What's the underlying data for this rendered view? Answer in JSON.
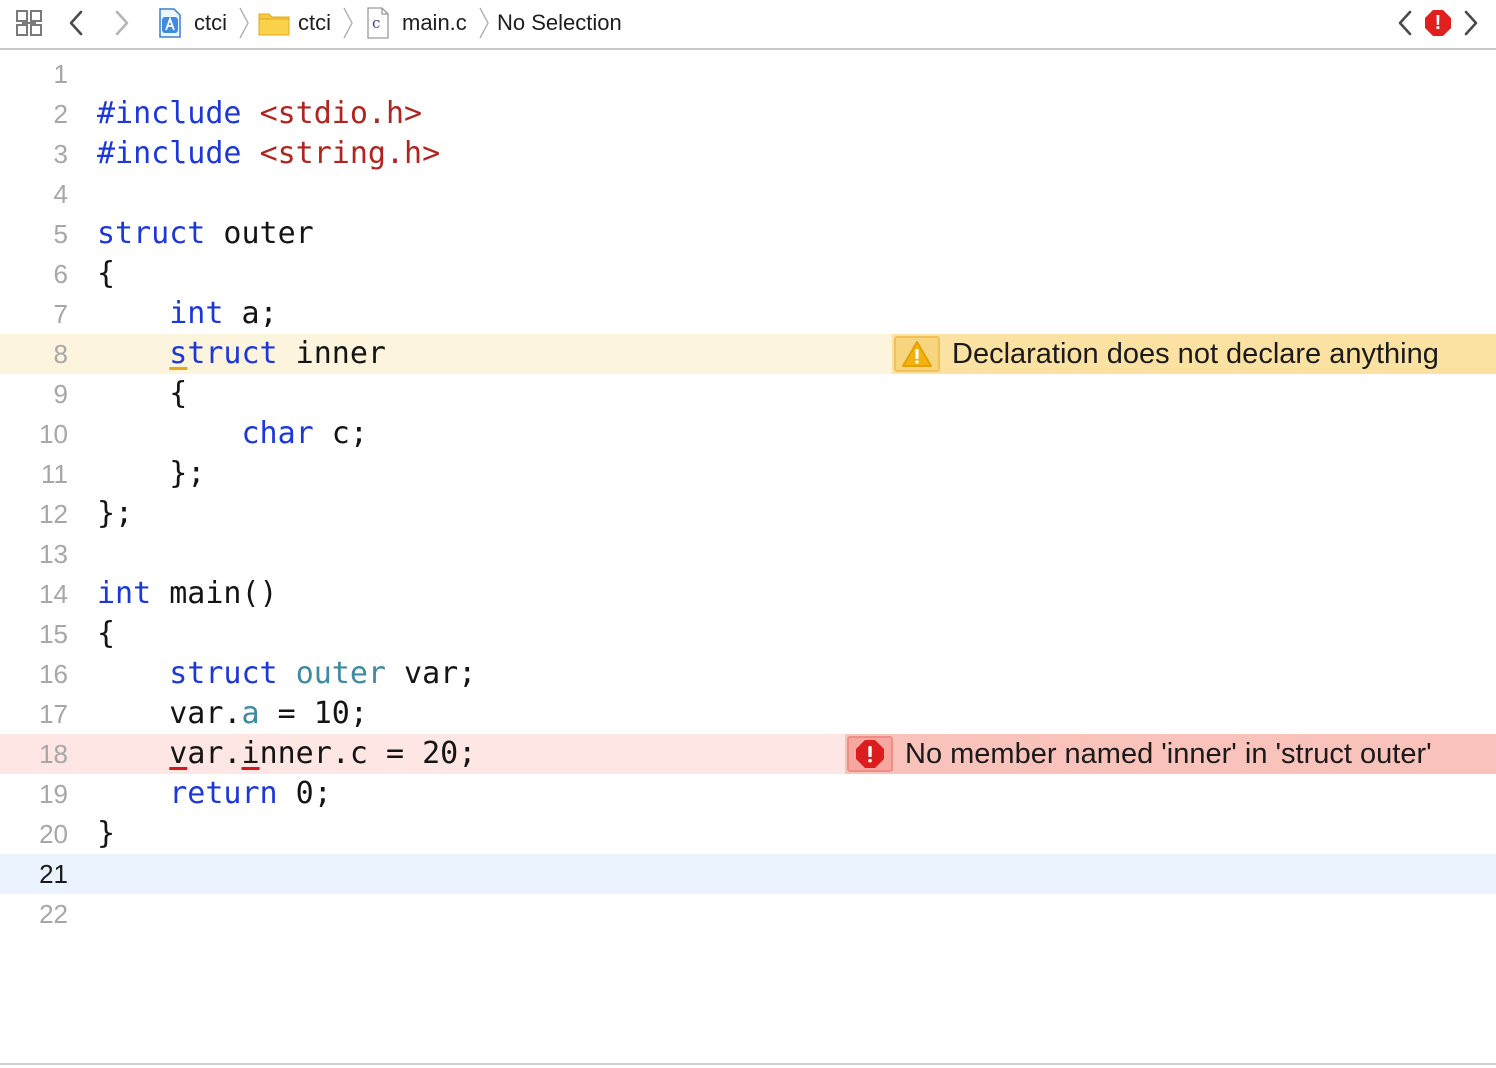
{
  "jumpbar": {
    "crumbs": [
      {
        "label": "ctci",
        "icon": "xcode-project-icon"
      },
      {
        "label": "ctci",
        "icon": "folder-icon"
      },
      {
        "label": "main.c",
        "icon": "c-file-icon",
        "badge": "c"
      },
      {
        "label": "No Selection"
      }
    ],
    "error_indicator": "!"
  },
  "colors": {
    "keyword": "#1d38d9",
    "string": "#b0251f",
    "type_ref": "#3d8aa3",
    "warning_line": "#fdf4dd",
    "warning_banner": "#fbe2a2",
    "error_line": "#fde6e3",
    "error_banner": "#f9c3bc",
    "current_line": "#ebf3fe"
  },
  "editor": {
    "current_line": 21,
    "lines": [
      {
        "n": "1",
        "tokens": []
      },
      {
        "n": "2",
        "tokens": [
          {
            "t": "#include",
            "c": "kw"
          },
          {
            "t": " "
          },
          {
            "t": "<stdio.h>",
            "c": "str"
          }
        ]
      },
      {
        "n": "3",
        "tokens": [
          {
            "t": "#include",
            "c": "kw"
          },
          {
            "t": " "
          },
          {
            "t": "<string.h>",
            "c": "str"
          }
        ]
      },
      {
        "n": "4",
        "tokens": []
      },
      {
        "n": "5",
        "tokens": [
          {
            "t": "struct",
            "c": "kw"
          },
          {
            "t": " outer"
          }
        ]
      },
      {
        "n": "6",
        "tokens": [
          {
            "t": "{"
          }
        ]
      },
      {
        "n": "7",
        "tokens": [
          {
            "t": "    "
          },
          {
            "t": "int",
            "c": "kw"
          },
          {
            "t": " a;"
          }
        ]
      },
      {
        "n": "8",
        "state": "warn",
        "tokens": [
          {
            "t": "    "
          },
          {
            "t": "s",
            "c": "kw sq-warn"
          },
          {
            "t": "truct",
            "c": "kw"
          },
          {
            "t": " inner"
          }
        ]
      },
      {
        "n": "9",
        "tokens": [
          {
            "t": "    {"
          }
        ]
      },
      {
        "n": "10",
        "tokens": [
          {
            "t": "        "
          },
          {
            "t": "char",
            "c": "kw"
          },
          {
            "t": " c;"
          }
        ]
      },
      {
        "n": "11",
        "tokens": [
          {
            "t": "    };"
          }
        ]
      },
      {
        "n": "12",
        "tokens": [
          {
            "t": "};"
          }
        ]
      },
      {
        "n": "13",
        "tokens": []
      },
      {
        "n": "14",
        "tokens": [
          {
            "t": "int",
            "c": "kw"
          },
          {
            "t": " main()"
          }
        ]
      },
      {
        "n": "15",
        "tokens": [
          {
            "t": "{"
          }
        ]
      },
      {
        "n": "16",
        "tokens": [
          {
            "t": "    "
          },
          {
            "t": "struct",
            "c": "kw"
          },
          {
            "t": " "
          },
          {
            "t": "outer",
            "c": "typ"
          },
          {
            "t": " var;"
          }
        ]
      },
      {
        "n": "17",
        "tokens": [
          {
            "t": "    var."
          },
          {
            "t": "a",
            "c": "fld"
          },
          {
            "t": " = 10;"
          }
        ]
      },
      {
        "n": "18",
        "state": "err",
        "tokens": [
          {
            "t": "    "
          },
          {
            "t": "v",
            "c": "sq-err"
          },
          {
            "t": "ar."
          },
          {
            "t": "i",
            "c": "sq-err"
          },
          {
            "t": "nner.c = 20;"
          }
        ]
      },
      {
        "n": "19",
        "tokens": [
          {
            "t": "    "
          },
          {
            "t": "return",
            "c": "kw"
          },
          {
            "t": " 0;"
          }
        ]
      },
      {
        "n": "20",
        "tokens": [
          {
            "t": "}"
          }
        ]
      },
      {
        "n": "21",
        "state": "current",
        "tokens": []
      },
      {
        "n": "22",
        "tokens": []
      }
    ]
  },
  "issues": [
    {
      "line": "8",
      "kind": "warning",
      "icon": "warning-triangle-icon",
      "message": "Declaration does not declare anything"
    },
    {
      "line": "18",
      "kind": "error",
      "icon": "error-octagon-icon",
      "message": "No member named 'inner' in 'struct outer'"
    }
  ]
}
